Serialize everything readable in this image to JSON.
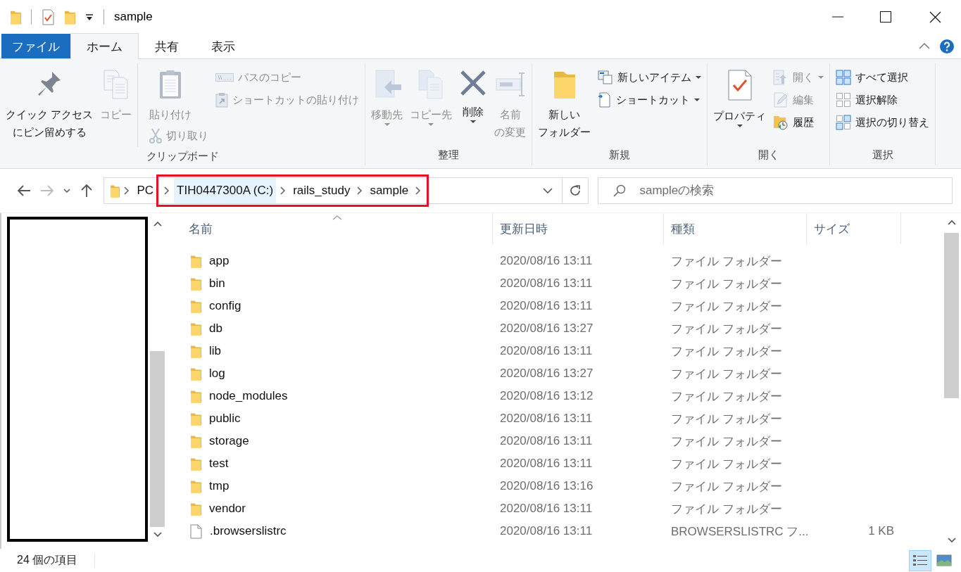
{
  "window": {
    "title": "sample"
  },
  "tabs": [
    {
      "label": "ファイル",
      "kind": "file",
      "selected": false
    },
    {
      "label": "ホーム",
      "kind": "tab",
      "selected": true
    },
    {
      "label": "共有",
      "kind": "tab",
      "selected": false
    },
    {
      "label": "表示",
      "kind": "tab",
      "selected": false
    }
  ],
  "ribbon": {
    "groups": [
      {
        "label": "クリップボード",
        "columns": [
          [
            {
              "kind": "large",
              "label_lines": [
                "クイック アクセス",
                "にピン留めする"
              ],
              "disabled": false,
              "dropdown": false
            }
          ],
          [
            {
              "kind": "large",
              "label": "コピー",
              "disabled": true,
              "dropdown": false
            }
          ],
          [
            {
              "kind": "large",
              "label": "貼り付け",
              "disabled": true,
              "dropdown": false
            },
            {
              "kind": "small",
              "label": "切り取り",
              "disabled": true,
              "dropdown": false
            }
          ],
          [
            {
              "kind": "small",
              "label": "パスのコピー",
              "disabled": true,
              "dropdown": false
            },
            {
              "kind": "small",
              "label": "ショートカットの貼り付け",
              "disabled": true,
              "dropdown": false
            }
          ]
        ]
      },
      {
        "label": "整理",
        "columns": [
          [
            {
              "kind": "large",
              "label": "移動先",
              "disabled": true,
              "dropdown": true
            }
          ],
          [
            {
              "kind": "large",
              "label": "コピー先",
              "disabled": true,
              "dropdown": true
            }
          ],
          [
            {
              "kind": "large",
              "label": "削除",
              "disabled": false,
              "dropdown": true
            }
          ],
          [
            {
              "kind": "large",
              "label_lines": [
                "名前",
                "の変更"
              ],
              "disabled": true,
              "dropdown": false
            }
          ]
        ]
      },
      {
        "label": "新規",
        "columns": [
          [
            {
              "kind": "large",
              "label_lines": [
                "新しい",
                "フォルダー"
              ],
              "disabled": false,
              "dropdown": false
            }
          ],
          [
            {
              "kind": "small",
              "label": "新しいアイテム",
              "disabled": false,
              "dropdown": true
            },
            {
              "kind": "small",
              "label": "ショートカット",
              "disabled": false,
              "dropdown": true
            }
          ]
        ]
      },
      {
        "label": "開く",
        "columns": [
          [
            {
              "kind": "large",
              "label": "プロパティ",
              "disabled": false,
              "dropdown": true
            }
          ],
          [
            {
              "kind": "small",
              "label": "開く",
              "disabled": true,
              "dropdown": true
            },
            {
              "kind": "small",
              "label": "編集",
              "disabled": true,
              "dropdown": false
            },
            {
              "kind": "small",
              "label": "履歴",
              "disabled": false,
              "dropdown": false
            }
          ]
        ]
      },
      {
        "label": "選択",
        "columns": [
          [
            {
              "kind": "small",
              "label": "すべて選択",
              "disabled": false,
              "dropdown": false
            },
            {
              "kind": "small",
              "label": "選択解除",
              "disabled": false,
              "dropdown": false
            },
            {
              "kind": "small",
              "label": "選択の切り替え",
              "disabled": false,
              "dropdown": false
            }
          ]
        ]
      }
    ]
  },
  "address": {
    "segments": [
      {
        "label": "PC",
        "highlighted": false,
        "hover": false
      },
      {
        "label": "TIH0447300A (C:)",
        "highlighted": true,
        "hover": true
      },
      {
        "label": "rails_study",
        "highlighted": true,
        "hover": false
      },
      {
        "label": "sample",
        "highlighted": true,
        "hover": false
      }
    ]
  },
  "search": {
    "placeholder": "sampleの検索"
  },
  "file_list": {
    "columns": [
      "名前",
      "更新日時",
      "種類",
      "サイズ"
    ],
    "rows": [
      {
        "kind": "folder",
        "name": "app",
        "modified": "2020/08/16 13:11",
        "type": "ファイル フォルダー"
      },
      {
        "kind": "folder",
        "name": "bin",
        "modified": "2020/08/16 13:11",
        "type": "ファイル フォルダー"
      },
      {
        "kind": "folder",
        "name": "config",
        "modified": "2020/08/16 13:11",
        "type": "ファイル フォルダー"
      },
      {
        "kind": "folder",
        "name": "db",
        "modified": "2020/08/16 13:27",
        "type": "ファイル フォルダー"
      },
      {
        "kind": "folder",
        "name": "lib",
        "modified": "2020/08/16 13:11",
        "type": "ファイル フォルダー"
      },
      {
        "kind": "folder",
        "name": "log",
        "modified": "2020/08/16 13:27",
        "type": "ファイル フォルダー"
      },
      {
        "kind": "folder",
        "name": "node_modules",
        "modified": "2020/08/16 13:12",
        "type": "ファイル フォルダー"
      },
      {
        "kind": "folder",
        "name": "public",
        "modified": "2020/08/16 13:11",
        "type": "ファイル フォルダー"
      },
      {
        "kind": "folder",
        "name": "storage",
        "modified": "2020/08/16 13:11",
        "type": "ファイル フォルダー"
      },
      {
        "kind": "folder",
        "name": "test",
        "modified": "2020/08/16 13:11",
        "type": "ファイル フォルダー"
      },
      {
        "kind": "folder",
        "name": "tmp",
        "modified": "2020/08/16 13:16",
        "type": "ファイル フォルダー"
      },
      {
        "kind": "folder",
        "name": "vendor",
        "modified": "2020/08/16 13:11",
        "type": "ファイル フォルダー"
      },
      {
        "kind": "file",
        "name": ".browserslistrc",
        "modified": "2020/08/16 13:11",
        "type": "BROWSERSLISTRC フ...",
        "size": "1 KB"
      }
    ]
  },
  "status_bar": {
    "item_count": "24 個の項目",
    "views": [
      {
        "kind": "details",
        "selected": true
      },
      {
        "kind": "large_icons",
        "selected": false
      }
    ]
  }
}
